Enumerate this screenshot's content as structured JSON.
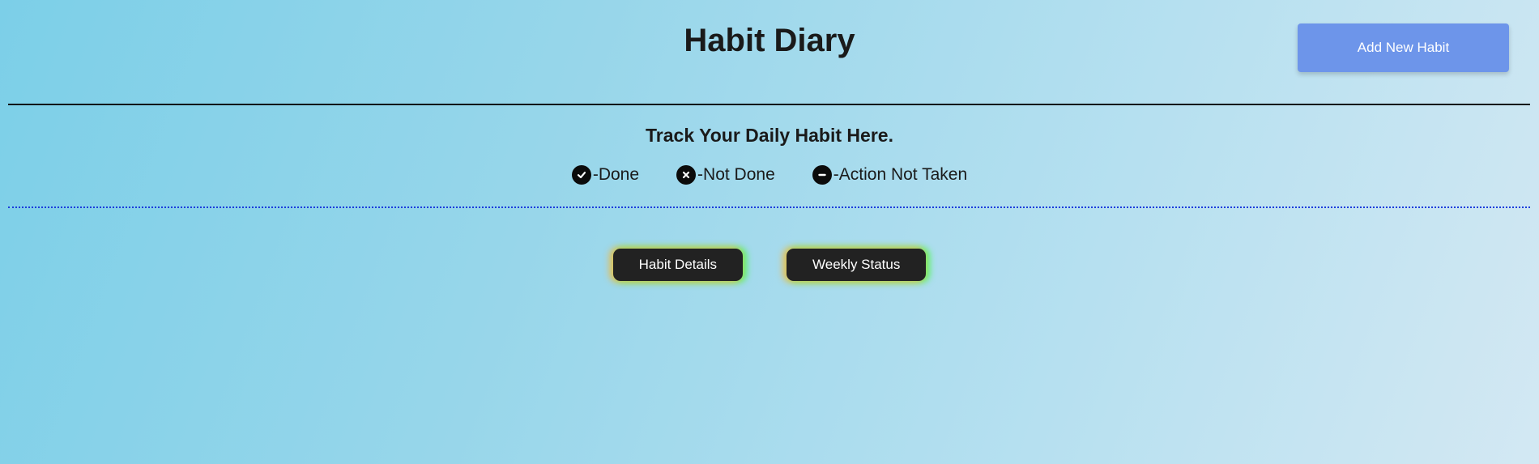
{
  "header": {
    "title": "Habit Diary",
    "add_button_label": "Add New Habit"
  },
  "intro": {
    "subtitle": "Track Your Daily Habit Here.",
    "legend": [
      {
        "icon": "check-circle-icon",
        "label": "-Done"
      },
      {
        "icon": "x-circle-icon",
        "label": "-Not Done"
      },
      {
        "icon": "minus-circle-icon",
        "label": "-Action Not Taken"
      }
    ]
  },
  "views": {
    "habit_details_label": "Habit Details",
    "weekly_status_label": "Weekly Status"
  },
  "colors": {
    "add_button": "#6d95ea",
    "dark_button": "#222222",
    "dotted_rule": "#1a3cdc"
  }
}
